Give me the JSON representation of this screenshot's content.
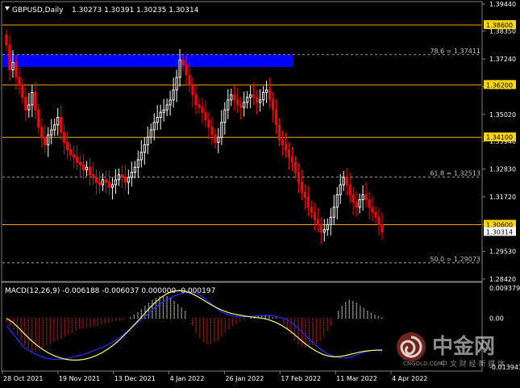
{
  "header": {
    "symbol": "GBPUSD,Daily",
    "ohlc": "1.30273 1.30391 1.30235 1.30314"
  },
  "macd": {
    "label": "MACD(12,26,9) -0.006188 -0.006037 0.000000 -0.000197",
    "axis_labels": [
      "0.009379",
      "0.00",
      "-0.013941"
    ]
  },
  "watermark": {
    "brand": "中金网",
    "url": "CNGOLD.COM",
    "slogan": "中 文 财 经 新 媒 体",
    "logo_icon": "spiral-logo-icon"
  },
  "colors": {
    "background": "#000000",
    "bull_candle": "#ffffff",
    "bear_candle": "#ff0000",
    "level_line": "#ffa500",
    "price_tag": "#ffd700",
    "fib_line": "#c0c0c0",
    "zone": "#0000ff",
    "macd_main": "#2030ff",
    "macd_signal": "#ffff66",
    "macd_hist_pos": "#ffffff",
    "macd_hist_neg": "#ff2020"
  },
  "chart_data": {
    "type": "candlestick",
    "symbol": "GBPUSD",
    "timeframe": "Daily",
    "last_close": 1.30314,
    "x_tick_labels": [
      "28 Oct 2021",
      "19 Nov 2021",
      "13 Dec 2021",
      "4 Jan 2022",
      "26 Jan 2022",
      "17 Feb 2022",
      "11 Mar 2022",
      "4 Apr 2022"
    ],
    "y_tick_labels": [
      "1.39440",
      "1.38350",
      "1.37240",
      "1.36130",
      "1.35020",
      "1.33940",
      "1.32830",
      "1.31720",
      "1.30610",
      "1.29530",
      "1.28420"
    ],
    "ylim": [
      1.2842,
      1.3944
    ],
    "horizontal_levels": [
      {
        "label": "1.38600",
        "value": 1.386
      },
      {
        "label": "1.36200",
        "value": 1.362
      },
      {
        "label": "1.34100",
        "value": 1.341
      },
      {
        "label": "1.30600",
        "value": 1.306
      }
    ],
    "current_price_label": "1.30314",
    "fibonacci_levels": [
      {
        "label": "78.6 = 1.37411",
        "value": 1.37411
      },
      {
        "label": "61.8 = 1.32513",
        "value": 1.32513
      },
      {
        "label": "50.0 = 1.29073",
        "value": 1.29073
      }
    ],
    "zone": {
      "x_start": "28 Oct 2021",
      "x_end": "17 Feb 2022",
      "y_low": 1.3692,
      "y_high": 1.3742
    },
    "candle_closes": [
      1.378,
      1.368,
      1.371,
      1.365,
      1.362,
      1.357,
      1.352,
      1.354,
      1.359,
      1.352,
      1.345,
      1.341,
      1.338,
      1.342,
      1.344,
      1.346,
      1.349,
      1.343,
      1.339,
      1.336,
      1.334,
      1.333,
      1.331,
      1.33,
      1.328,
      1.329,
      1.326,
      1.325,
      1.323,
      1.322,
      1.324,
      1.323,
      1.321,
      1.322,
      1.324,
      1.326,
      1.325,
      1.323,
      1.325,
      1.327,
      1.329,
      1.332,
      1.335,
      1.338,
      1.341,
      1.344,
      1.347,
      1.349,
      1.351,
      1.352,
      1.354,
      1.356,
      1.36,
      1.365,
      1.372,
      1.37,
      1.366,
      1.362,
      1.358,
      1.354,
      1.353,
      1.351,
      1.348,
      1.345,
      1.342,
      1.339,
      1.341,
      1.347,
      1.352,
      1.356,
      1.358,
      1.356,
      1.354,
      1.353,
      1.355,
      1.357,
      1.358,
      1.357,
      1.355,
      1.356,
      1.359,
      1.36,
      1.356,
      1.352,
      1.346,
      1.34,
      1.338,
      1.336,
      1.333,
      1.331,
      1.327,
      1.323,
      1.319,
      1.317,
      1.313,
      1.311,
      1.308,
      1.306,
      1.303,
      1.304,
      1.306,
      1.309,
      1.313,
      1.318,
      1.322,
      1.325,
      1.322,
      1.318,
      1.315,
      1.313,
      1.316,
      1.318,
      1.316,
      1.313,
      1.311,
      1.309,
      1.306,
      1.3031
    ],
    "macd_ylim": [
      -0.013941,
      0.009379
    ],
    "macd_histogram": [
      -0.001,
      -0.002,
      -0.003,
      -0.0045,
      -0.006,
      -0.0075,
      -0.0085,
      -0.009,
      -0.009,
      -0.0085,
      -0.008,
      -0.0075,
      -0.007,
      -0.0065,
      -0.006,
      -0.0055,
      -0.005,
      -0.0045,
      -0.004,
      -0.0035,
      -0.003,
      -0.0028,
      -0.0026,
      -0.0024,
      -0.0022,
      -0.002,
      -0.0018,
      -0.0015,
      -0.0012,
      -0.001,
      -0.0008,
      -0.0006,
      -0.0003,
      0.0,
      0.0005,
      0.001,
      0.0018,
      0.0026,
      0.0034,
      0.0042,
      0.005,
      0.0056,
      0.006,
      0.0062,
      0.006,
      0.0055,
      0.0048,
      0.004,
      0.003,
      0.002,
      0.0,
      -0.002,
      -0.004,
      -0.0055,
      -0.0065,
      -0.007,
      -0.007,
      -0.0065,
      -0.006,
      -0.005,
      -0.004,
      -0.003,
      -0.002,
      -0.0015,
      -0.001,
      -0.0005,
      0.0,
      0.0003,
      0.0006,
      0.0008,
      0.0009,
      0.0008,
      0.0006,
      0.0004,
      0.0002,
      0.0,
      -0.0015,
      -0.003,
      -0.0045,
      -0.006,
      -0.007,
      -0.0075,
      -0.0078,
      -0.0078,
      -0.0075,
      -0.007,
      -0.006,
      -0.005,
      -0.0035,
      -0.002,
      0.0,
      0.002,
      0.0035,
      0.0045,
      0.005,
      0.0048,
      0.0042,
      0.0035,
      0.0028,
      0.0022,
      0.0015,
      0.001,
      0.0006,
      0.0004
    ],
    "macd_main_line": [
      -0.002,
      -0.004,
      -0.006,
      -0.008,
      -0.009,
      -0.0098,
      -0.0105,
      -0.011,
      -0.0112,
      -0.0112,
      -0.011,
      -0.0106,
      -0.0102,
      -0.0098,
      -0.0092,
      -0.0086,
      -0.008,
      -0.0072,
      -0.0063,
      -0.0052,
      -0.004,
      -0.0026,
      -0.0012,
      0.0002,
      0.0016,
      0.003,
      0.0042,
      0.0052,
      0.006,
      0.0066,
      0.007,
      0.0072,
      0.0068,
      0.0058,
      0.0044,
      0.003,
      0.0018,
      0.001,
      0.0006,
      0.0004,
      0.0004,
      0.0005,
      0.0007,
      0.0008,
      0.0008,
      0.0006,
      0.0002,
      -0.0004,
      -0.0014,
      -0.0028,
      -0.0044,
      -0.006,
      -0.0075,
      -0.0088,
      -0.0098,
      -0.0104,
      -0.0108,
      -0.0108,
      -0.0104,
      -0.0098,
      -0.0092,
      -0.0088,
      -0.0086,
      -0.0085
    ],
    "macd_signal_line": [
      0.0,
      -0.001,
      -0.0025,
      -0.0042,
      -0.0058,
      -0.0072,
      -0.0084,
      -0.0094,
      -0.0102,
      -0.0108,
      -0.0112,
      -0.0114,
      -0.0114,
      -0.0112,
      -0.0108,
      -0.0102,
      -0.0094,
      -0.0084,
      -0.0072,
      -0.0058,
      -0.0042,
      -0.0025,
      -0.0008,
      0.001,
      0.0028,
      0.0044,
      0.0058,
      0.0068,
      0.0074,
      0.0076,
      0.0074,
      0.0068,
      0.006,
      0.005,
      0.004,
      0.0031,
      0.0023,
      0.0017,
      0.0012,
      0.0009,
      0.0006,
      0.0004,
      0.0002,
      0.0,
      -0.0004,
      -0.001,
      -0.0018,
      -0.0028,
      -0.004,
      -0.0054,
      -0.0068,
      -0.008,
      -0.009,
      -0.0098,
      -0.0103,
      -0.0105,
      -0.0104,
      -0.0101,
      -0.0097,
      -0.0093,
      -0.009,
      -0.0088,
      -0.0087,
      -0.0087
    ]
  }
}
